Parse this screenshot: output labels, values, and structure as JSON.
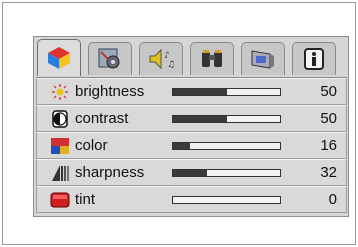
{
  "tabs": [
    {
      "icon": "colored-shapes-icon",
      "active": true
    },
    {
      "icon": "gear-tools-icon",
      "active": false
    },
    {
      "icon": "speaker-music-icon",
      "active": false
    },
    {
      "icon": "binoculars-icon",
      "active": false
    },
    {
      "icon": "monitor-icon",
      "active": false
    },
    {
      "icon": "info-icon",
      "active": false
    }
  ],
  "settings": [
    {
      "label": "brightness",
      "value": "50",
      "level": 0.5,
      "icon": "sun-icon"
    },
    {
      "label": "contrast",
      "value": "50",
      "level": 0.5,
      "icon": "contrast-icon"
    },
    {
      "label": "color",
      "value": "16",
      "level": 0.16,
      "icon": "color-icon"
    },
    {
      "label": "sharpness",
      "value": "32",
      "level": 0.32,
      "icon": "sharpness-icon"
    },
    {
      "label": "tint",
      "value": "0",
      "level": 0.0,
      "icon": "tint-icon"
    }
  ],
  "colors": {
    "track_fill": "#3a3a3a",
    "panel": "#d6d6d6"
  }
}
